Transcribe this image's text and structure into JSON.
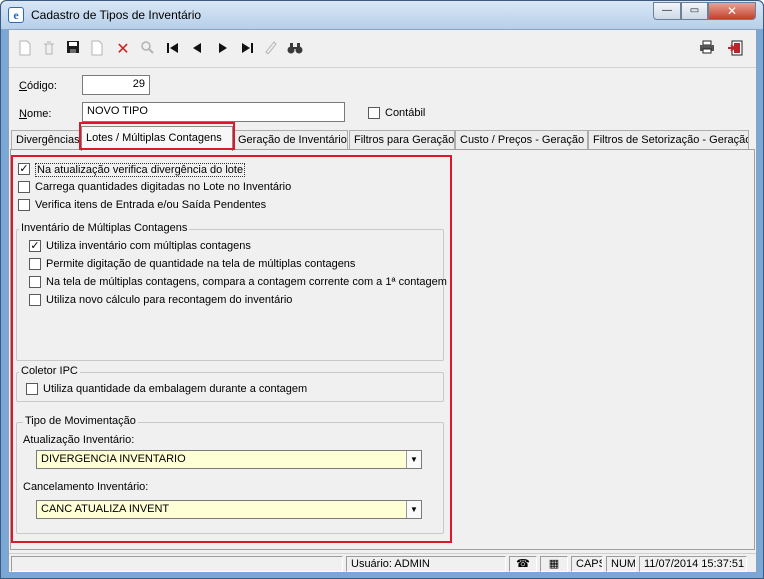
{
  "window": {
    "title": "Cadastro de Tipos de Inventário",
    "app_icon": "e",
    "min_glyph": "—",
    "max_glyph": "▭",
    "close_glyph": "✕"
  },
  "toolbar": {
    "icons": [
      "new-icon",
      "delete-icon",
      "save-icon",
      "copy-icon",
      "cancel-icon",
      "search-icon",
      "first-icon",
      "prev-icon",
      "next-icon",
      "last-icon",
      "filter-icon",
      "find-icon",
      "print-icon",
      "exit-icon"
    ]
  },
  "form": {
    "codigo_label_key": "C",
    "codigo_label_rest": "ódigo:",
    "codigo_value": "29",
    "nome_label_key": "N",
    "nome_label_rest": "ome:",
    "nome_value": "NOVO TIPO",
    "contabil_label": "Contábil",
    "contabil_checked": false
  },
  "tabs": [
    {
      "label": "Divergências"
    },
    {
      "label": "Lotes / Múltiplas Contagens"
    },
    {
      "label": "Geração de Inventário"
    },
    {
      "label": "Filtros para Geração"
    },
    {
      "label": "Custo / Preços - Geração"
    },
    {
      "label": "Filtros de Setorização - Geração"
    }
  ],
  "lotes": {
    "options": [
      {
        "label": "Na atualização verifica divergência do lote",
        "checked": true
      },
      {
        "label": "Carrega quantidades digitadas no Lote no Inventário",
        "checked": false
      },
      {
        "label": "Verifica itens de Entrada e/ou Saída Pendentes",
        "checked": false
      }
    ]
  },
  "multiplas": {
    "legend": "Inventário de Múltiplas Contagens",
    "options": [
      {
        "label": "Utiliza inventário com múltiplas contagens",
        "checked": true
      },
      {
        "label": "Permite digitação de quantidade na tela de múltiplas contagens",
        "checked": false
      },
      {
        "label": "Na tela de múltiplas contagens, compara a contagem corrente com a 1ª contagem",
        "checked": false
      },
      {
        "label": "Utiliza novo cálculo para recontagem do inventário",
        "checked": false
      }
    ]
  },
  "coletor": {
    "legend": "Coletor IPC",
    "option": {
      "label": "Utiliza quantidade da embalagem durante a contagem",
      "checked": false
    }
  },
  "movimentacao": {
    "legend": "Tipo de Movimentação",
    "atualizacao_label": "Atualização Inventário:",
    "atualizacao_value": "DIVERGENCIA INVENTARIO",
    "cancelamento_label": "Cancelamento Inventário:",
    "cancelamento_value": "CANC ATUALIZA INVENT"
  },
  "status": {
    "usuario": "Usuário: ADMIN",
    "caps": "CAPS",
    "num": "NUM",
    "datetime": "11/07/2014 15:37:51"
  }
}
